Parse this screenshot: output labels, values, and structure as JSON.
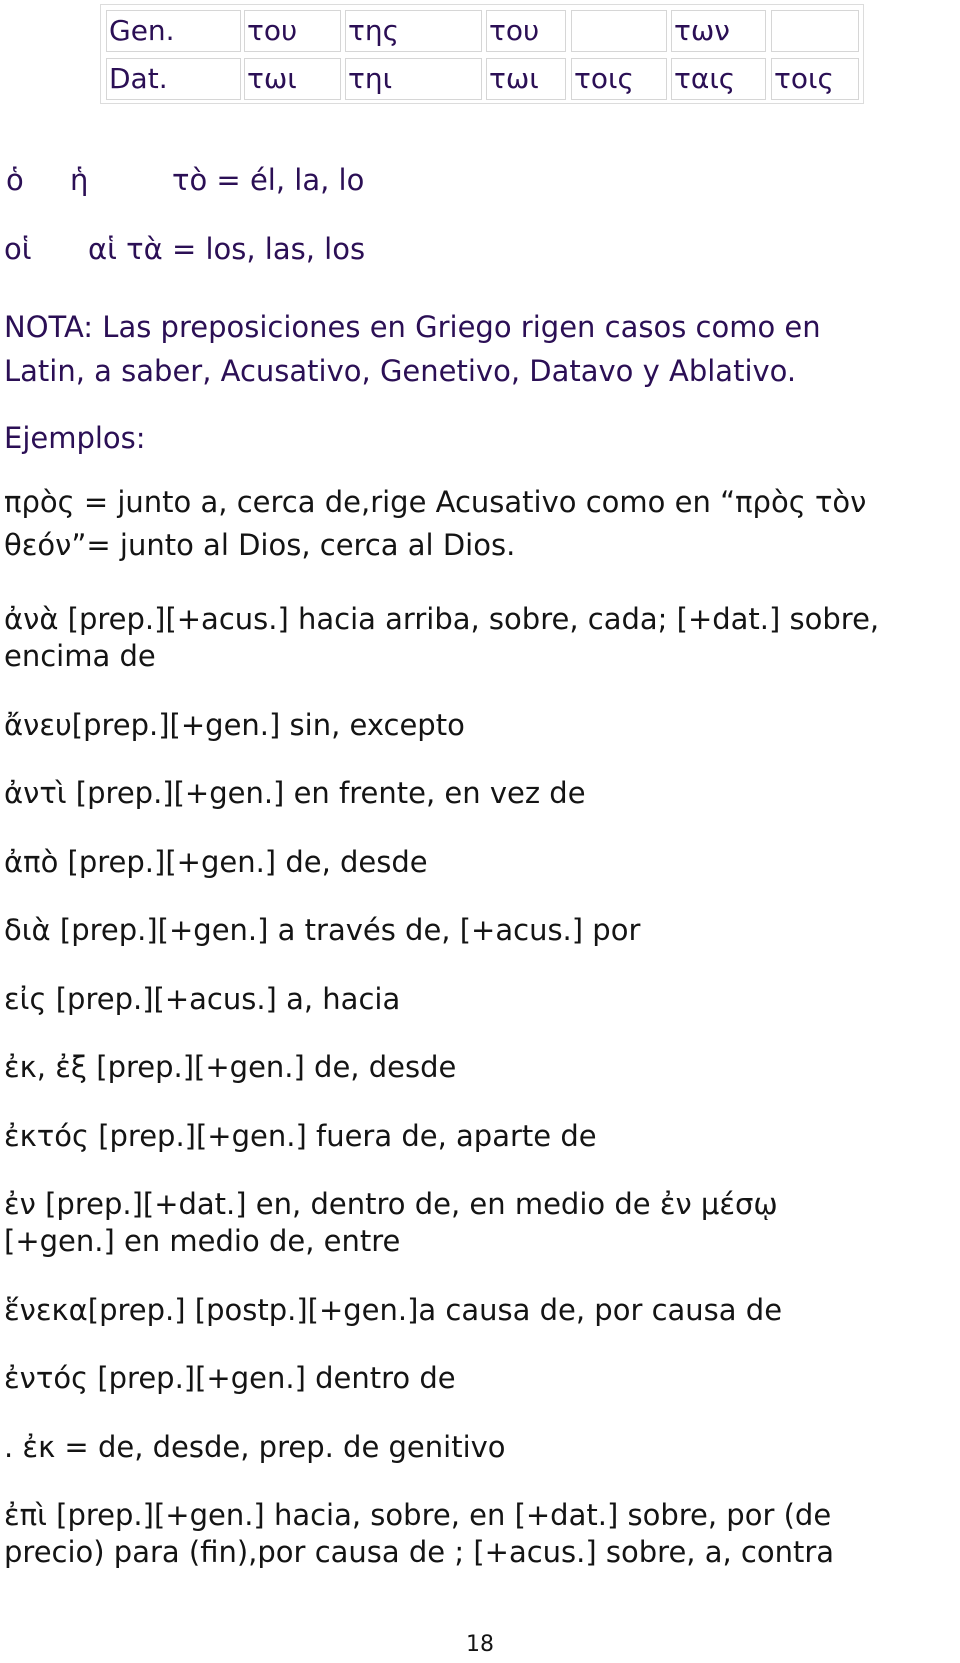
{
  "declension_table": {
    "rows": [
      {
        "case": "Gen.",
        "cells": [
          "του",
          "της",
          "του",
          "",
          "των",
          ""
        ]
      },
      {
        "case": "Dat.",
        "cells": [
          "τωι",
          "τηι",
          "τωι",
          "τοις",
          "ταις",
          "τοις"
        ]
      }
    ]
  },
  "articles": {
    "singular": {
      "masc": "ὁ",
      "fem": "ἡ",
      "neut_and_meaning": "τὸ = él, la, lo"
    },
    "plural": {
      "masc": "οἱ",
      "fem_neut_and_meaning": "αἱ τὰ = los, las, los"
    }
  },
  "note": {
    "line1": "NOTA: Las preposiciones en Griego rigen casos como en",
    "line2": "Latin, a saber, Acusativo, Genetivo, Datavo y Ablativo."
  },
  "examples_heading": "Ejemplos:",
  "example": {
    "line1": "πρὸς = junto a, cerca de,rige Acusativo como en “πρὸς τὸν",
    "line2": "θεόν”= junto al Dios, cerca al Dios."
  },
  "prepositions": [
    {
      "lines": [
        "ἀνὰ [prep.][+acus.] hacia arriba, sobre, cada; [+dat.] sobre,",
        "encima de"
      ]
    },
    {
      "lines": [
        "ἄνευ[prep.][+gen.] sin, excepto"
      ]
    },
    {
      "lines": [
        "ἀντὶ [prep.][+gen.] en frente, en vez de"
      ]
    },
    {
      "lines": [
        "ἀπὸ [prep.][+gen.] de, desde"
      ]
    },
    {
      "lines": [
        "διὰ [prep.][+gen.] a través de, [+acus.] por"
      ]
    },
    {
      "lines": [
        "εἰς [prep.][+acus.] a, hacia"
      ]
    },
    {
      "lines": [
        "ἐκ, ἐξ [prep.][+gen.] de, desde"
      ]
    },
    {
      "lines": [
        "ἐκτός [prep.][+gen.] fuera de, aparte de"
      ]
    },
    {
      "lines": [
        "ἐν [prep.][+dat.] en, dentro de, en medio de ἐν μέσῳ",
        "[+gen.] en medio de, entre"
      ]
    },
    {
      "lines": [
        "ἕνεκα[prep.] [postp.][+gen.]a causa de, por causa de"
      ]
    },
    {
      "lines": [
        "ἐντός [prep.][+gen.] dentro de"
      ]
    },
    {
      "lines": [
        ". ἐκ = de, desde, prep. de genitivo"
      ]
    },
    {
      "lines": [
        "ἐπὶ [prep.][+gen.] hacia, sobre, en [+dat.] sobre, por (de",
        "precio) para (fin),por causa de ; [+acus.] sobre, a, contra"
      ]
    }
  ],
  "page_number": "18",
  "colors": {
    "heading_text": "#2b0f55",
    "body_text": "#141414",
    "table_border": "#d6d6d6"
  }
}
